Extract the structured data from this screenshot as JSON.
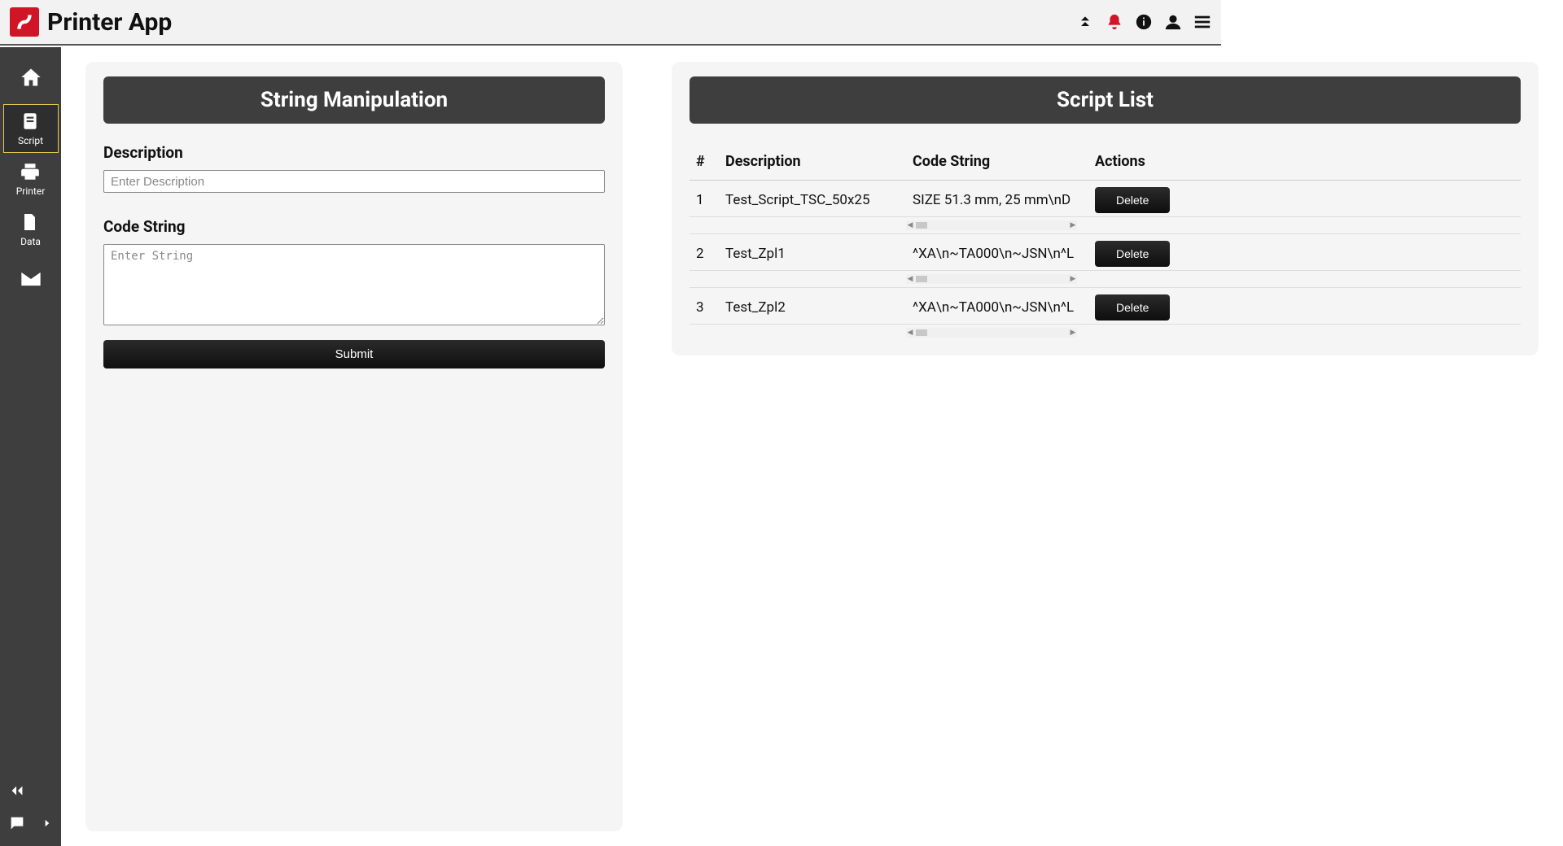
{
  "app": {
    "title": "Printer App"
  },
  "sidebar": {
    "items": [
      {
        "label": "",
        "icon": "home"
      },
      {
        "label": "Script",
        "icon": "book"
      },
      {
        "label": "Printer",
        "icon": "print"
      },
      {
        "label": "Data",
        "icon": "zip"
      },
      {
        "label": "",
        "icon": "mail"
      }
    ]
  },
  "form": {
    "card_title": "String Manipulation",
    "desc_label": "Description",
    "desc_placeholder": "Enter Description",
    "desc_value": "",
    "code_label": "Code String",
    "code_placeholder": "Enter String",
    "code_value": "",
    "submit_label": "Submit"
  },
  "list": {
    "card_title": "Script List",
    "headers": {
      "num": "#",
      "desc": "Description",
      "code": "Code String",
      "act": "Actions"
    },
    "delete_label": "Delete",
    "rows": [
      {
        "num": "1",
        "desc": "Test_Script_TSC_50x25",
        "code": "SIZE 51.3 mm, 25 mm\\nD"
      },
      {
        "num": "2",
        "desc": "Test_Zpl1",
        "code": "^XA\\n~TA000\\n~JSN\\n^L"
      },
      {
        "num": "3",
        "desc": "Test_Zpl2",
        "code": "^XA\\n~TA000\\n~JSN\\n^L"
      }
    ]
  }
}
